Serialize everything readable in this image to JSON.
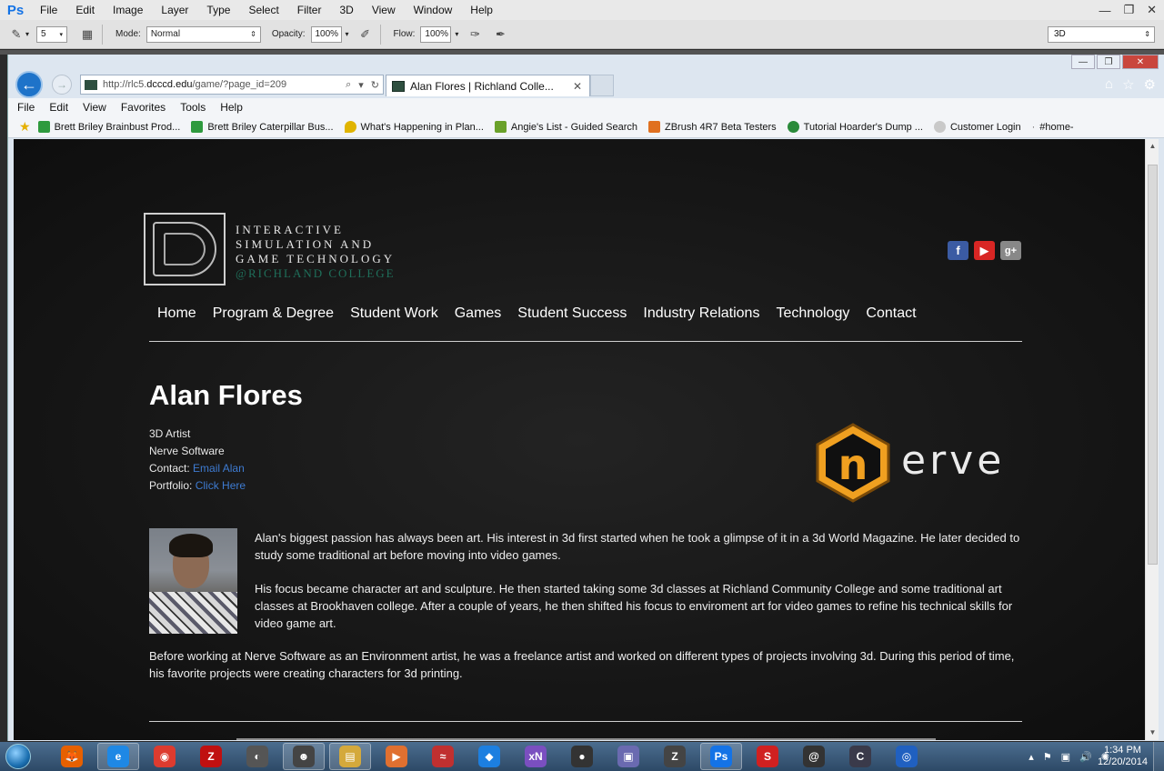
{
  "photoshop": {
    "logo": "Ps",
    "menu": [
      "File",
      "Edit",
      "Image",
      "Layer",
      "Type",
      "Select",
      "Filter",
      "3D",
      "View",
      "Window",
      "Help"
    ],
    "options": {
      "brush_size": "5",
      "mode_label": "Mode:",
      "mode_value": "Normal",
      "opacity_label": "Opacity:",
      "opacity_value": "100%",
      "flow_label": "Flow:",
      "flow_value": "100%",
      "workspace": "3D"
    }
  },
  "browser": {
    "url_prefix": "http://rlc5.",
    "url_host": "dcccd.edu",
    "url_path": "/game/?page_id=209",
    "tab_title": "Alan Flores | Richland Colle...",
    "menu": [
      "File",
      "Edit",
      "View",
      "Favorites",
      "Tools",
      "Help"
    ],
    "favorites": [
      {
        "label": "Brett Briley Brainbust Prod...",
        "color": "#2e9a3e"
      },
      {
        "label": "Brett Briley Caterpillar Bus...",
        "color": "#2e9a3e"
      },
      {
        "label": "What's Happening in Plan...",
        "color": "#e0b400"
      },
      {
        "label": "Angie's List - Guided Search",
        "color": "#6aa12a"
      },
      {
        "label": "ZBrush 4R7 Beta Testers",
        "color": "#e07020"
      },
      {
        "label": "Tutorial Hoarder's Dump ...",
        "color": "#2a8a3a"
      },
      {
        "label": "Customer Login",
        "color": "#aaaaaa"
      },
      {
        "label": "#home-",
        "color": "#888888"
      }
    ]
  },
  "site": {
    "logo_lines": [
      "INTERACTIVE",
      "SIMULATION AND",
      "GAME TECHNOLOGY",
      "@RICHLAND COLLEGE"
    ],
    "social": [
      "f",
      "▶",
      "g+"
    ],
    "nav": [
      "Home",
      "Program & Degree",
      "Student Work",
      "Games",
      "Student Success",
      "Industry Relations",
      "Technology",
      "Contact"
    ],
    "profile": {
      "name": "Alan Flores",
      "role": "3D Artist",
      "company": "Nerve Software",
      "contact_label": "Contact:",
      "contact_link": "Email Alan",
      "portfolio_label": "Portfolio:",
      "portfolio_link": "Click Here",
      "company_logo_letter": "n",
      "company_logo_word": "erve",
      "bio_p1": "Alan's biggest passion has always been art. His interest in 3d first started when he took a glimpse of it in a 3d World Magazine. He later decided to study some traditional art before moving into video games.",
      "bio_p2": "His focus became character art and sculpture. He then started taking some 3d classes at Richland Community College and some traditional art classes at Brookhaven college. After a couple of years, he then shifted his focus to enviroment art for video games to refine his technical skills for video game art.",
      "bio_p3": "Before working at Nerve Software as an Environment artist, he was a freelance artist and worked on different types of projects involving 3d. During this period of time, his favorite projects were creating characters for 3d printing."
    },
    "colors": {
      "accent_link": "#3e7bd1",
      "nerve_orange": "#f0a020",
      "rc_green": "#1f6f5a"
    }
  },
  "taskbar": {
    "apps": [
      {
        "name": "firefox-icon",
        "glyph": "🦊",
        "color": "#e66000",
        "active": false
      },
      {
        "name": "ie-icon",
        "glyph": "e",
        "color": "#1e88e5",
        "active": true
      },
      {
        "name": "chrome-icon",
        "glyph": "◉",
        "color": "#dd3b2f",
        "active": false
      },
      {
        "name": "filezilla-icon",
        "glyph": "Z",
        "color": "#c01010",
        "active": false
      },
      {
        "name": "app-circle-icon",
        "glyph": "◐",
        "color": "#555555",
        "active": false
      },
      {
        "name": "app-mask-icon",
        "glyph": "☻",
        "color": "#444444",
        "active": true
      },
      {
        "name": "explorer-icon",
        "glyph": "▤",
        "color": "#d4a93c",
        "active": true
      },
      {
        "name": "media-icon",
        "glyph": "▶",
        "color": "#e07030",
        "active": false
      },
      {
        "name": "app-wave-icon",
        "glyph": "≈",
        "color": "#c03030",
        "active": false
      },
      {
        "name": "dropbox-icon",
        "glyph": "◆",
        "color": "#1c7fe0",
        "active": false
      },
      {
        "name": "xnview-icon",
        "glyph": "xN",
        "color": "#7a4fc0",
        "active": false
      },
      {
        "name": "app-game-icon",
        "glyph": "●",
        "color": "#333333",
        "active": false
      },
      {
        "name": "app-window-icon",
        "glyph": "▣",
        "color": "#6a6ab0",
        "active": false
      },
      {
        "name": "zbrush-icon",
        "glyph": "Z",
        "color": "#444444",
        "active": false
      },
      {
        "name": "photoshop-icon",
        "glyph": "Ps",
        "color": "#1473e6",
        "active": true
      },
      {
        "name": "app-s-icon",
        "glyph": "S",
        "color": "#d02020",
        "active": false
      },
      {
        "name": "app-swirl-icon",
        "glyph": "@",
        "color": "#333333",
        "active": false
      },
      {
        "name": "app-c-icon",
        "glyph": "C",
        "color": "#3a3a4a",
        "active": false
      },
      {
        "name": "app-ring-icon",
        "glyph": "◎",
        "color": "#2060c0",
        "active": false
      }
    ],
    "time": "1:34 PM",
    "date": "12/20/2014"
  }
}
